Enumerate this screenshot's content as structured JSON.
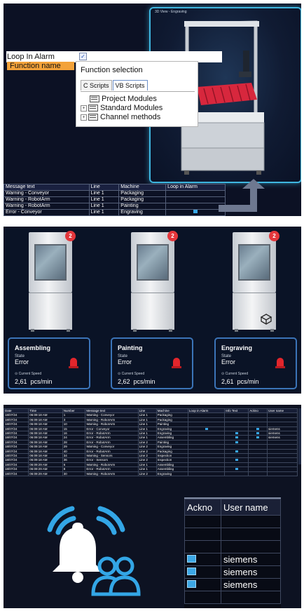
{
  "panel1": {
    "view_title": "3D View - Engraving",
    "property_rows": [
      {
        "label": "Loop In Alarm",
        "checked": true
      },
      {
        "label": "Function name"
      }
    ],
    "dialog": {
      "title": "Function selection",
      "tabs": [
        "C Scripts",
        "VB Scripts"
      ],
      "active_tab": "VB Scripts",
      "tree": [
        "Project Modules",
        "Standard Modules",
        "Channel methods"
      ]
    },
    "table": {
      "columns": [
        "Message text",
        "Line",
        "Machine",
        "Loop in Alarm"
      ],
      "rows": [
        [
          "Warning - Conveyor",
          "Line 1",
          "Packaging",
          ""
        ],
        [
          "Warning - RobotArm",
          "Line 1",
          "Packaging",
          ""
        ],
        [
          "Warning - RobotArm",
          "Line 1",
          "Painting",
          ""
        ],
        [
          "Error - Conveyor",
          "Line 1",
          "Engraving",
          "checked"
        ]
      ]
    }
  },
  "panel2": {
    "stations": [
      {
        "name": "Assembling",
        "badge": "2",
        "state_label": "State",
        "state": "Error",
        "speed_label": "Current Speed",
        "speed": "2,61",
        "unit": "pcs/min"
      },
      {
        "name": "Painting",
        "badge": "2",
        "state_label": "State",
        "state": "Error",
        "speed_label": "Current Speed",
        "speed": "2,62",
        "unit": "pcs/min"
      },
      {
        "name": "Engraving",
        "badge": "2",
        "state_label": "State",
        "state": "Error",
        "speed_label": "Current Speed",
        "speed": "2,61",
        "unit": "pcs/min"
      }
    ],
    "colors": {
      "card_border": "#3b74b8",
      "badge": "#e4363b",
      "alarm": "#e2262c"
    }
  },
  "panel3": {
    "columns": [
      "Date",
      "Time",
      "Number",
      "Message text",
      "Line",
      "Machine",
      "Loop in Alarm",
      "Info Text",
      "Ackno",
      "User name"
    ],
    "rows": [
      [
        "18/07/24",
        "06:09:18 AM",
        "1",
        "Warning - Conveyor",
        "Line 1",
        "Packaging",
        "",
        "",
        "",
        ""
      ],
      [
        "18/07/24",
        "06:09:18 AM",
        "3",
        "Warning - RobotArm",
        "Line 1",
        "Packaging",
        "",
        "",
        "",
        ""
      ],
      [
        "18/07/24",
        "06:09:18 AM",
        "10",
        "Warning - RobotArm",
        "Line 1",
        "Painting",
        "",
        "",
        "",
        ""
      ],
      [
        "18/07/24",
        "06:09:18 AM",
        "15",
        "Error - Conveyor",
        "Line 1",
        "Engraving",
        "x",
        "",
        "x",
        "siemens"
      ],
      [
        "18/07/24",
        "06:09:18 AM",
        "16",
        "Error - RobotArm",
        "Line 1",
        "Engraving",
        "",
        "x",
        "x",
        "siemens"
      ],
      [
        "18/07/24",
        "06:09:18 AM",
        "24",
        "Error - RobotArm",
        "Line 1",
        "Assembling",
        "",
        "x",
        "x",
        "siemens"
      ],
      [
        "18/07/24",
        "06:09:18 AM",
        "28",
        "Error - RobotArm",
        "Line 2",
        "Painting",
        "",
        "x",
        "",
        ""
      ],
      [
        "18/07/24",
        "06:09:18 AM",
        "29",
        "Warning - Conveyor",
        "Line 2",
        "Engraving",
        "",
        "",
        "",
        ""
      ],
      [
        "18/07/24",
        "06:09:18 AM",
        "40",
        "Error - RobotArm",
        "Line 2",
        "Packaging",
        "",
        "x",
        "",
        ""
      ],
      [
        "18/07/24",
        "06:09:18 AM",
        "34",
        "Warning - Sensors",
        "Line 2",
        "Inspection",
        "",
        "",
        "",
        ""
      ],
      [
        "18/07/24",
        "06:09:18 AM",
        "36",
        "Error - Sensors",
        "Line 2",
        "Inspection",
        "",
        "x",
        "",
        ""
      ],
      [
        "18/07/24",
        "06:09:29 AM",
        "6",
        "Warning - RobotArm",
        "Line 1",
        "Assembling",
        "",
        "",
        "",
        ""
      ],
      [
        "18/07/24",
        "06:09:29 AM",
        "8",
        "Error - RobotArm",
        "Line 1",
        "Assembling",
        "",
        "x",
        "",
        ""
      ],
      [
        "18/07/24",
        "06:09:29 AM",
        "30",
        "Warning - RobotArm",
        "Line 2",
        "Engraving",
        "",
        "",
        "",
        ""
      ]
    ],
    "zoom": {
      "columns": [
        "Ackno",
        "User name"
      ],
      "rows": [
        [
          "",
          ""
        ],
        [
          "",
          ""
        ],
        [
          "",
          ""
        ],
        [
          "checked",
          "siemens"
        ],
        [
          "checked",
          "siemens"
        ],
        [
          "checked",
          "siemens"
        ],
        [
          "",
          ""
        ]
      ]
    }
  }
}
